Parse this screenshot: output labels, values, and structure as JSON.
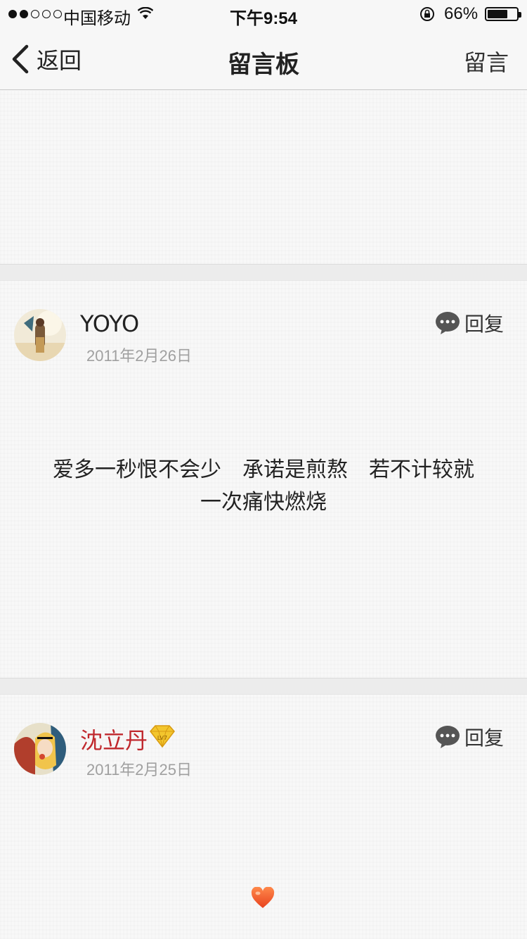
{
  "status_bar": {
    "carrier": "中国移动",
    "time": "下午9:54",
    "battery_percent": "66%",
    "battery_level": 0.66,
    "signal_bars": 2
  },
  "nav": {
    "back_label": "返回",
    "title": "留言板",
    "right_action": "留言"
  },
  "posts": [
    {
      "username": "YOYO",
      "date": "2011年2月26日",
      "reply_label": "回复",
      "message_line1": "爱多一秒恨不会少　承诺是煎熬　若不计较就",
      "message_line2": "一次痛快燃烧"
    },
    {
      "username": "沈立丹",
      "username_color": "#c0282d",
      "date": "2011年2月25日",
      "reply_label": "回复",
      "badge_icon": "diamond-vip-icon",
      "message_icon": "heart-icon"
    }
  ]
}
